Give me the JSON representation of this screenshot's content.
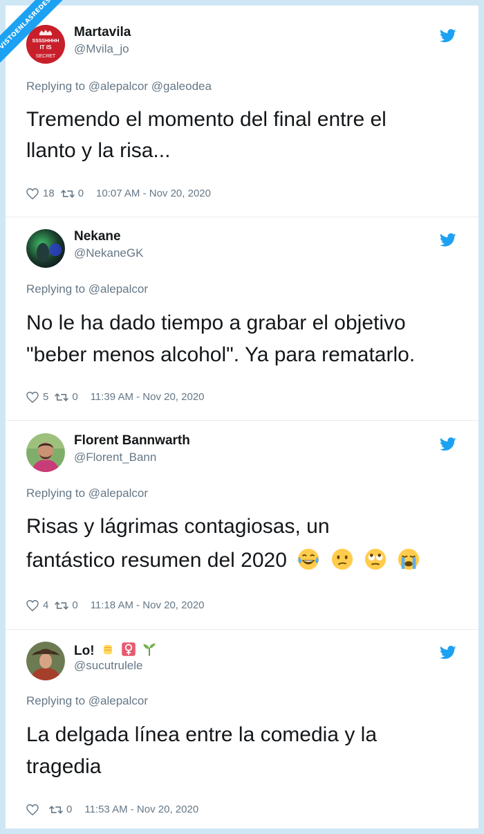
{
  "watermark": "VISTOENLASREDES .com",
  "tweets": [
    {
      "name": "Martavila",
      "handle": "@Mvila_jo",
      "avatar_text": "SSSSHHHH IT IS SECRET",
      "replying": "Replying to @alepalcor @galeodea",
      "body_line1": "Tremendo el momento del final entre el",
      "body_line2": "llanto y la risa...",
      "likes": "18",
      "retweets": "0",
      "timestamp": "10:07 AM - Nov 20, 2020"
    },
    {
      "name": "Nekane",
      "handle": "@NekaneGK",
      "replying": "Replying to @alepalcor",
      "body_line1": "No le ha dado tiempo a grabar el objetivo",
      "body_line2": "\"beber menos alcohol\". Ya para rematarlo.",
      "likes": "5",
      "retweets": "0",
      "timestamp": "11:39 AM - Nov 20, 2020"
    },
    {
      "name": "Florent Bannwarth",
      "handle": "@Florent_Bann",
      "replying": "Replying to @alepalcor",
      "body_line1": "Risas y lágrimas contagiosas, un",
      "body_line2": "fantástico resumen del 2020",
      "likes": "4",
      "retweets": "0",
      "timestamp": "11:18 AM - Nov 20, 2020"
    },
    {
      "name": "Lo!",
      "handle": "@sucutrulele",
      "replying": "Replying to @alepalcor",
      "body_line1": "La delgada línea entre la comedia y la",
      "body_line2": "tragedia",
      "likes": "",
      "retweets": "0",
      "timestamp": "11:53 AM - Nov 20, 2020"
    }
  ],
  "colors": {
    "twitter_blue": "#1da1f2",
    "secondary_text": "#657786",
    "primary_text": "#14171a",
    "border": "#cfe6f5"
  },
  "icons": [
    "twitter-bird-icon",
    "heart-icon",
    "retweet-icon",
    "laughing-crying-emoji",
    "confused-emoji",
    "eye-roll-emoji",
    "crying-emoji",
    "raised-fist-emoji",
    "female-sign-emoji",
    "seedling-emoji"
  ]
}
